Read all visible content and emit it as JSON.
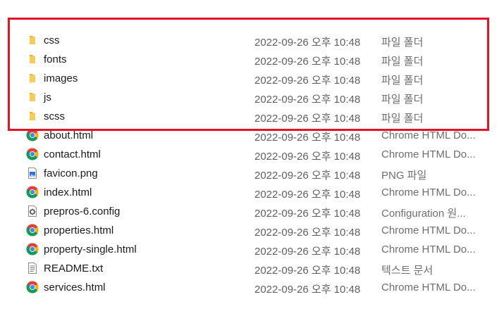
{
  "files": [
    {
      "name": "css",
      "date": "2022-09-26 오후 10:48",
      "type": "파일 폴더",
      "icon": "folder-icon"
    },
    {
      "name": "fonts",
      "date": "2022-09-26 오후 10:48",
      "type": "파일 폴더",
      "icon": "folder-icon"
    },
    {
      "name": "images",
      "date": "2022-09-26 오후 10:48",
      "type": "파일 폴더",
      "icon": "folder-icon"
    },
    {
      "name": "js",
      "date": "2022-09-26 오후 10:48",
      "type": "파일 폴더",
      "icon": "folder-icon"
    },
    {
      "name": "scss",
      "date": "2022-09-26 오후 10:48",
      "type": "파일 폴더",
      "icon": "folder-icon"
    },
    {
      "name": "about.html",
      "date": "2022-09-26 오후 10:48",
      "type": "Chrome HTML Do...",
      "icon": "chrome-icon"
    },
    {
      "name": "contact.html",
      "date": "2022-09-26 오후 10:48",
      "type": "Chrome HTML Do...",
      "icon": "chrome-icon"
    },
    {
      "name": "favicon.png",
      "date": "2022-09-26 오후 10:48",
      "type": "PNG 파일",
      "icon": "image-file-icon"
    },
    {
      "name": "index.html",
      "date": "2022-09-26 오후 10:48",
      "type": "Chrome HTML Do...",
      "icon": "chrome-icon"
    },
    {
      "name": "prepros-6.config",
      "date": "2022-09-26 오후 10:48",
      "type": "Configuration 원...",
      "icon": "config-file-icon"
    },
    {
      "name": "properties.html",
      "date": "2022-09-26 오후 10:48",
      "type": "Chrome HTML Do...",
      "icon": "chrome-icon"
    },
    {
      "name": "property-single.html",
      "date": "2022-09-26 오후 10:48",
      "type": "Chrome HTML Do...",
      "icon": "chrome-icon"
    },
    {
      "name": "README.txt",
      "date": "2022-09-26 오후 10:48",
      "type": "텍스트 문서",
      "icon": "text-file-icon"
    },
    {
      "name": "services.html",
      "date": "2022-09-26 오후 10:48",
      "type": "Chrome HTML Do...",
      "icon": "chrome-icon"
    }
  ],
  "colors": {
    "highlight_border": "#e3132a",
    "folder": "#f0c04a",
    "name_text": "#1a1a1a",
    "meta_text": "#5f5f5f"
  }
}
